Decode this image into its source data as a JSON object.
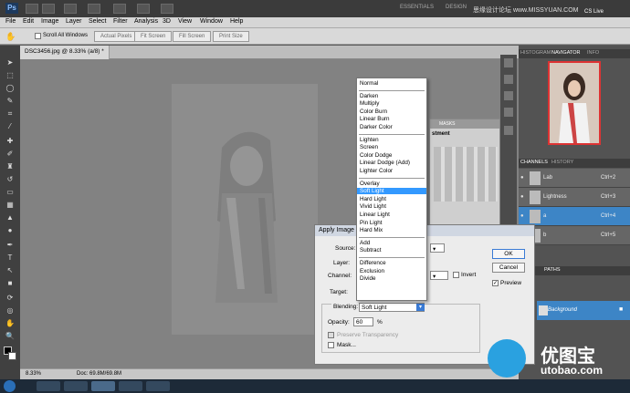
{
  "appbar": {
    "app_logo": "Ps",
    "workspaces": [
      "ESSENTIALS",
      "DESIGN"
    ],
    "cs_live": "CS Live",
    "watermark": "思缘设计论坛 www.MISSYUAN.COM"
  },
  "menu": [
    "File",
    "Edit",
    "Image",
    "Layer",
    "Select",
    "Filter",
    "Analysis",
    "3D",
    "View",
    "Window",
    "Help"
  ],
  "options": {
    "scroll_all": "Scroll All Windows",
    "buttons": [
      "Actual Pixels",
      "Fit Screen",
      "Fill Screen",
      "Print Size"
    ]
  },
  "document": {
    "tab_title": "DSC3456.jpg @ 8.33% (a/8) *",
    "zoom": "8.33%",
    "doc_info": "Doc: 69.8M/69.8M"
  },
  "panels": {
    "top_tabs": [
      "HISTOGRAM",
      "NAVIGATOR",
      "INFO"
    ],
    "mid_tabs": [
      "CHANNELS",
      "HISTORY"
    ],
    "channels": [
      {
        "name": "Lab",
        "shortcut": "Ctrl+2",
        "selected": false
      },
      {
        "name": "Lightness",
        "shortcut": "Ctrl+3",
        "selected": false
      },
      {
        "name": "a",
        "shortcut": "Ctrl+4",
        "selected": true
      },
      {
        "name": "b",
        "shortcut": "Ctrl+5",
        "selected": false
      }
    ],
    "bottom_tabs": [
      "PATHS"
    ],
    "layer_name": "Background",
    "partial_tabs": [
      "MASKS"
    ],
    "partial_label": "stment"
  },
  "dialog": {
    "title": "Apply Image",
    "source_label": "Source:",
    "layer_label": "Layer:",
    "channel_label": "Channel:",
    "invert_label": "Invert",
    "target_label": "Target:",
    "blending_label": "Blending:",
    "blending_value": "Soft Light",
    "opacity_label": "Opacity:",
    "opacity_value": "60",
    "opacity_unit": "%",
    "preserve_label": "Preserve Transparency",
    "mask_label": "Mask...",
    "ok": "OK",
    "cancel": "Cancel",
    "preview": "Preview"
  },
  "blend_modes": [
    [
      "Normal"
    ],
    [
      "Darken",
      "Multiply",
      "Color Burn",
      "Linear Burn",
      "Darker Color"
    ],
    [
      "Lighten",
      "Screen",
      "Color Dodge",
      "Linear Dodge (Add)",
      "Lighter Color"
    ],
    [
      "Overlay",
      "Soft Light",
      "Hard Light",
      "Vivid Light",
      "Linear Light",
      "Pin Light",
      "Hard Mix"
    ],
    [
      "Add",
      "Subtract"
    ],
    [
      "Difference",
      "Exclusion",
      "Divide"
    ]
  ],
  "selected_blend": "Soft Light",
  "watermark_logo": {
    "cn": "优图宝",
    "en": "utobao.com"
  },
  "colors": {
    "selection": "#3399ff",
    "channel_selected": "#3d85c6",
    "nav_frame": "#dd3333"
  }
}
